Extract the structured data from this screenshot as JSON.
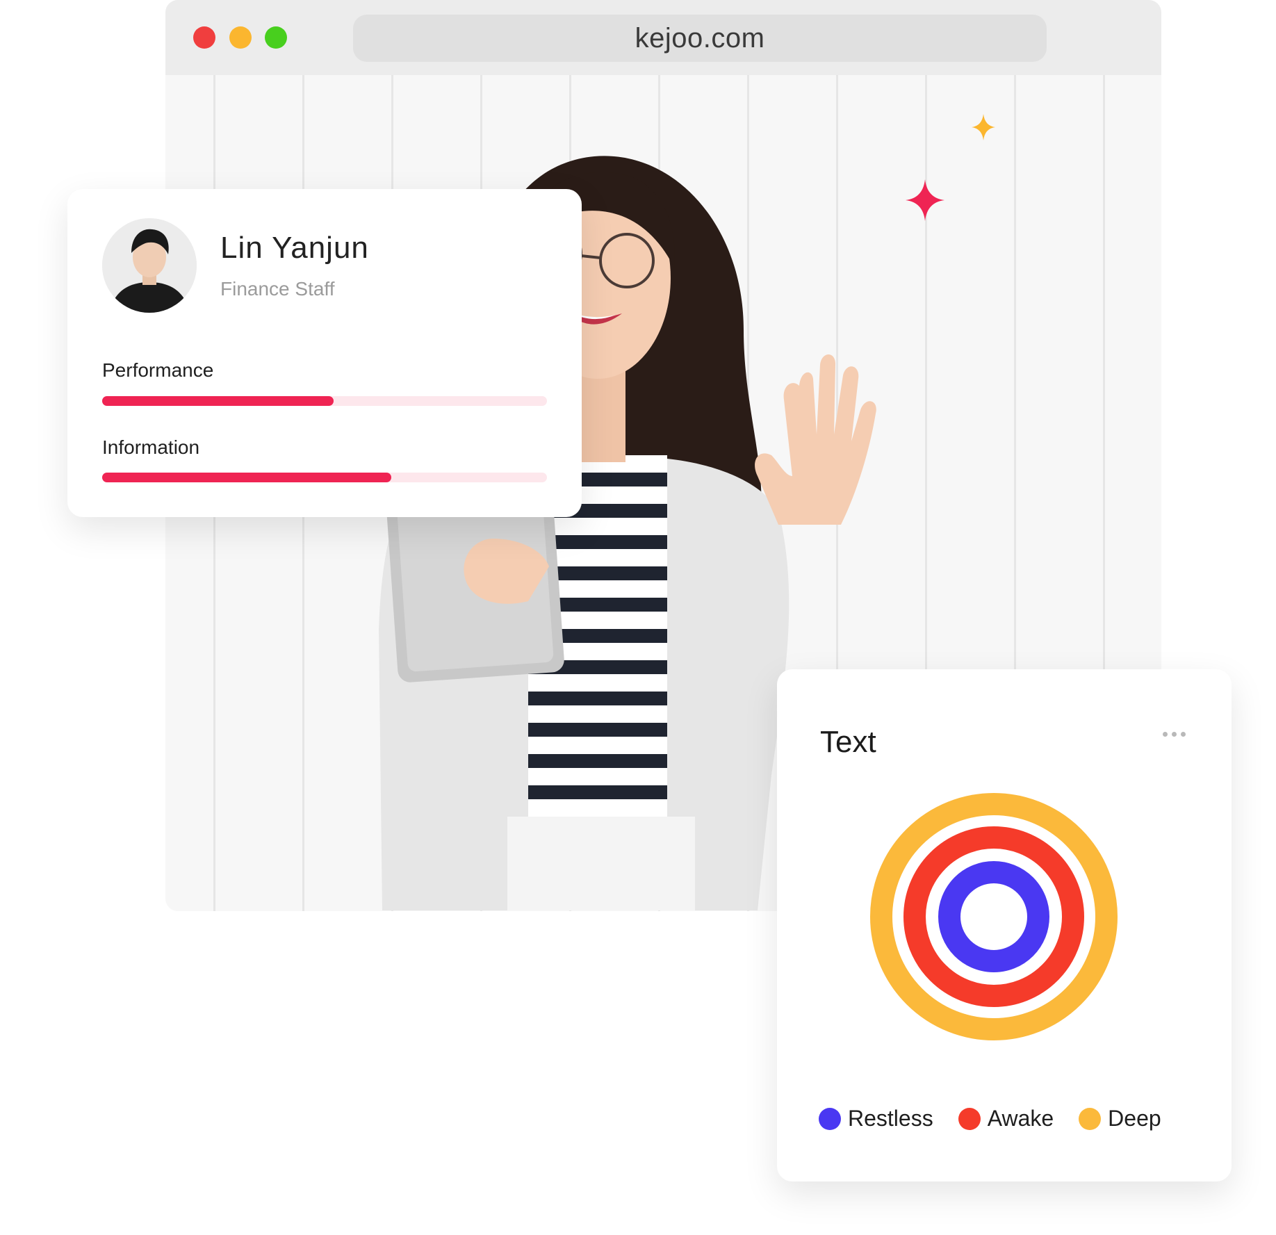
{
  "browser": {
    "url": "kejoo.com",
    "window_controls": [
      {
        "name": "close",
        "color": "#f03e3e"
      },
      {
        "name": "minimize",
        "color": "#fbb62f"
      },
      {
        "name": "maximize",
        "color": "#48cf1e"
      }
    ]
  },
  "profile": {
    "name": "Lin Yanjun",
    "role": "Finance Staff",
    "metrics": [
      {
        "label": "Performance",
        "progress": 0.52
      },
      {
        "label": "Information",
        "progress": 0.65
      }
    ],
    "accent": "#ef2453",
    "track": "#fde7ec"
  },
  "chart_card": {
    "title": "Text",
    "menu_icon": "more-horizontal-icon",
    "legend": [
      {
        "label": "Restless",
        "color": "#4a38f2"
      },
      {
        "label": "Awake",
        "color": "#f53b2a"
      },
      {
        "label": "Deep",
        "color": "#fbb93b"
      }
    ]
  },
  "decor": {
    "sparkle_colors": [
      "#fbb62f",
      "#ef2453"
    ]
  }
}
